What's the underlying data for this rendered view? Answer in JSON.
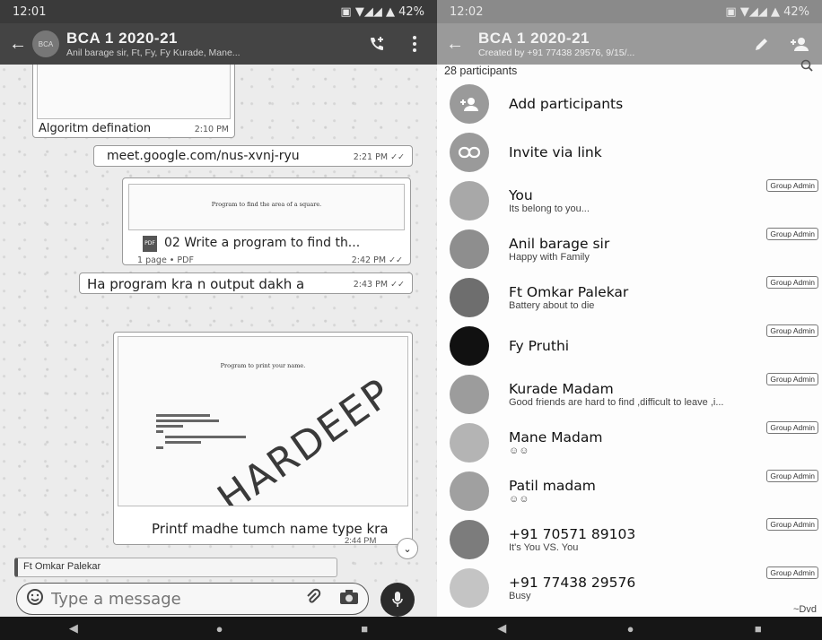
{
  "left": {
    "status": {
      "time": "12:01",
      "right": "42%"
    },
    "header": {
      "avatar_text": "BCA",
      "title": "BCA 1 2020-21",
      "subtitle": "Anil barage sir, Ft, Fy, Fy Kurade, Mane..."
    },
    "messages": {
      "m1_text": "Algoritm defination",
      "m1_time": "2:10 PM",
      "m2_text": "meet.google.com/nus-xvnj-ryu",
      "m2_time": "2:21 PM",
      "doc_preview_title": "Program to find the area of a square.",
      "doc_name": "02 Write a program to find th...",
      "doc_meta": "1 page • PDF",
      "doc_time": "2:42 PM",
      "m3_text": "Ha program kra n output dakh a",
      "m3_time": "2:43 PM",
      "img_title": "Program to print your name.",
      "img_watermark": "HARDEEP",
      "m4_text": "Printf madhe tumch name type kra",
      "m4_time": "2:44 PM",
      "reply_name": "Ft Omkar Palekar"
    },
    "input": {
      "placeholder": "Type a message"
    }
  },
  "right": {
    "status": {
      "time": "12:02",
      "right": "42%"
    },
    "header": {
      "title": "BCA 1 2020-21",
      "subtitle": "Created by +91 77438 29576, 9/15/..."
    },
    "participants_label": "28 participants",
    "actions": [
      {
        "label": "Add participants"
      },
      {
        "label": "Invite via link"
      }
    ],
    "participants": [
      {
        "name": "You",
        "status": "Its belong to you...",
        "badge": "Group Admin"
      },
      {
        "name": "Anil barage sir",
        "status": "Happy with Family",
        "badge": "Group Admin"
      },
      {
        "name": "Ft Omkar Palekar",
        "status": "Battery about to die",
        "badge": "Group Admin"
      },
      {
        "name": "Fy Pruthi",
        "status": "",
        "badge": "Group Admin"
      },
      {
        "name": "Kurade Madam",
        "status": "Good friends are hard to find ,difficult to leave ,i...",
        "badge": "Group Admin"
      },
      {
        "name": "Mane Madam",
        "status": "☺☺",
        "badge": "Group Admin"
      },
      {
        "name": "Patil madam",
        "status": "☺☺",
        "badge": "Group Admin"
      },
      {
        "name": "+91 70571 89103",
        "status": "It's You VS. You",
        "badge": "Group Admin"
      },
      {
        "name": "+91 77438 29576",
        "status": "Busy",
        "badge": "Group Admin"
      }
    ],
    "corner_text": "~Dvd"
  }
}
